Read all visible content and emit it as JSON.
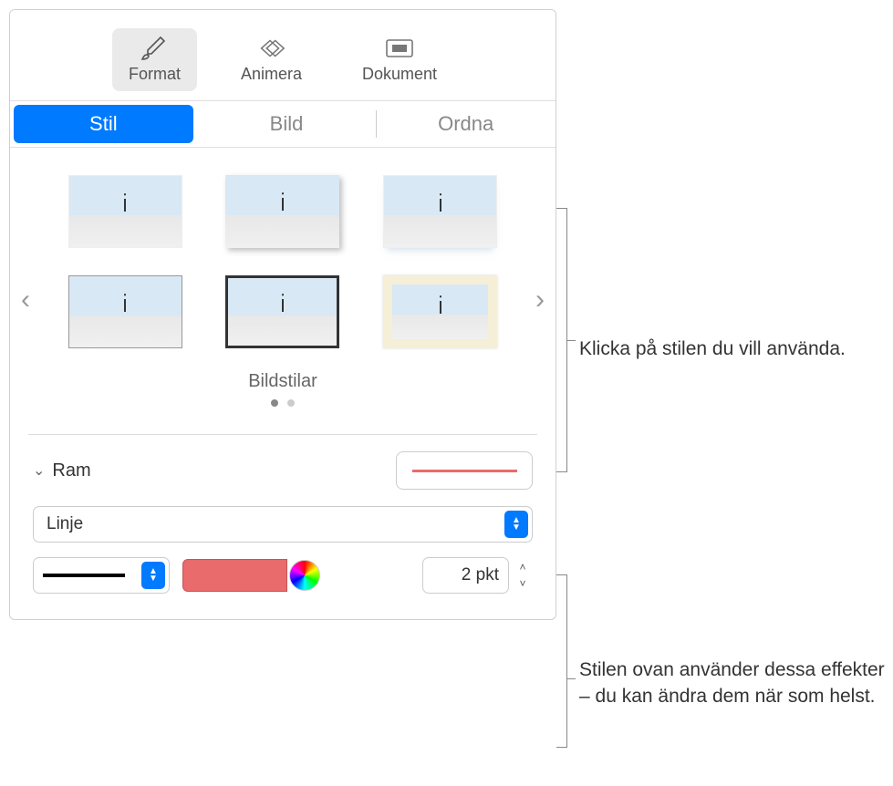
{
  "toolbar": {
    "format": "Format",
    "animate": "Animera",
    "document": "Dokument"
  },
  "subtabs": {
    "style": "Stil",
    "image": "Bild",
    "arrange": "Ordna"
  },
  "styles": {
    "label": "Bildstilar"
  },
  "frame": {
    "title": "Ram",
    "type_label": "Linje",
    "width_value": "2 pkt",
    "color": "#e96b6b"
  },
  "callouts": {
    "c1": "Klicka på stilen du vill använda.",
    "c2": "Stilen ovan använder dessa effekter – du kan ändra dem när som helst."
  }
}
